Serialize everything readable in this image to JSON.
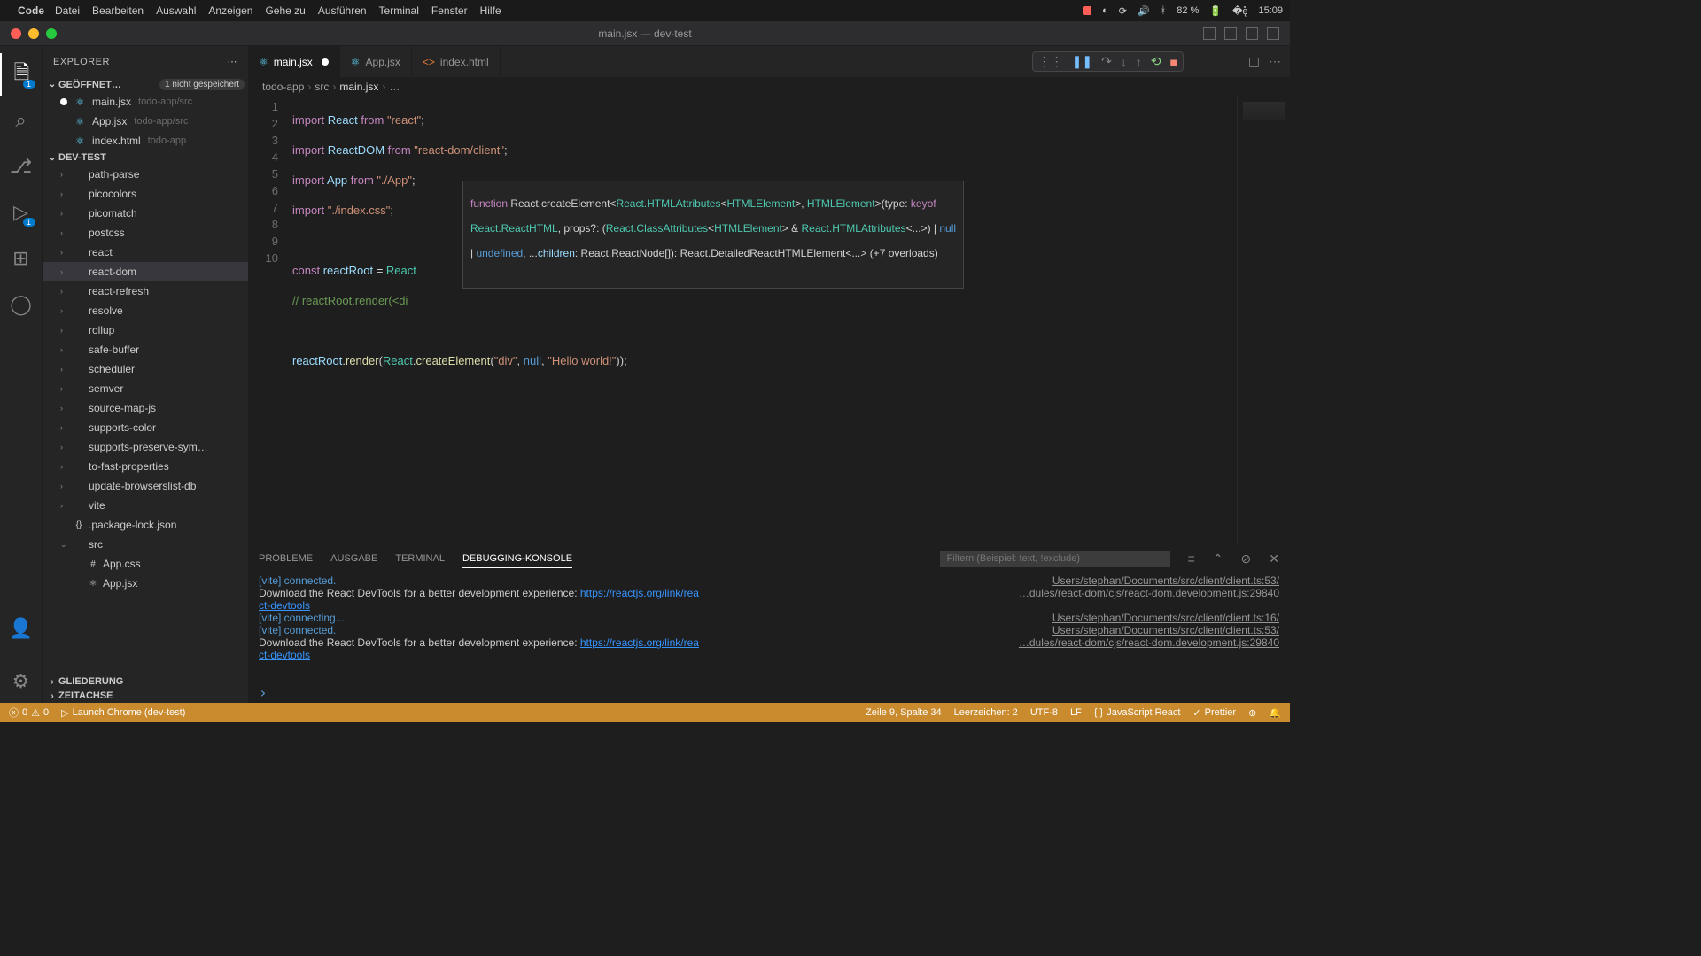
{
  "menubar": {
    "app": "Code",
    "items": [
      "Datei",
      "Bearbeiten",
      "Auswahl",
      "Anzeigen",
      "Gehe zu",
      "Ausführen",
      "Terminal",
      "Fenster",
      "Hilfe"
    ],
    "battery": "82 %",
    "time": "15:09"
  },
  "titlebar": "main.jsx — dev-test",
  "activitybar": {
    "explorer_badge": "1",
    "debug_badge": "1"
  },
  "sidebar": {
    "title": "EXPLORER",
    "open_editors": {
      "label": "GEÖFFNET…",
      "tag": "1 nicht gespeichert",
      "items": [
        {
          "name": "main.jsx",
          "path": "todo-app/src",
          "dirty": true
        },
        {
          "name": "App.jsx",
          "path": "todo-app/src",
          "dirty": false
        },
        {
          "name": "index.html",
          "path": "todo-app",
          "dirty": false
        }
      ]
    },
    "workspace": {
      "label": "DEV-TEST",
      "tree": [
        {
          "name": "path-parse",
          "type": "folder"
        },
        {
          "name": "picocolors",
          "type": "folder"
        },
        {
          "name": "picomatch",
          "type": "folder"
        },
        {
          "name": "postcss",
          "type": "folder"
        },
        {
          "name": "react",
          "type": "folder"
        },
        {
          "name": "react-dom",
          "type": "folder",
          "selected": true
        },
        {
          "name": "react-refresh",
          "type": "folder"
        },
        {
          "name": "resolve",
          "type": "folder"
        },
        {
          "name": "rollup",
          "type": "folder"
        },
        {
          "name": "safe-buffer",
          "type": "folder"
        },
        {
          "name": "scheduler",
          "type": "folder"
        },
        {
          "name": "semver",
          "type": "folder"
        },
        {
          "name": "source-map-js",
          "type": "folder"
        },
        {
          "name": "supports-color",
          "type": "folder"
        },
        {
          "name": "supports-preserve-sym…",
          "type": "folder"
        },
        {
          "name": "to-fast-properties",
          "type": "folder"
        },
        {
          "name": "update-browserslist-db",
          "type": "folder"
        },
        {
          "name": "vite",
          "type": "folder"
        },
        {
          "name": ".package-lock.json",
          "type": "file",
          "icon": "{}"
        },
        {
          "name": "src",
          "type": "folder",
          "expanded": true
        },
        {
          "name": "App.css",
          "type": "file",
          "indent": 2,
          "icon": "#"
        },
        {
          "name": "App.jsx",
          "type": "file",
          "indent": 2,
          "icon": "⚛"
        }
      ]
    },
    "outline": "GLIEDERUNG",
    "timeline": "ZEITACHSE"
  },
  "tabs": [
    {
      "name": "main.jsx",
      "icon": "⚛",
      "active": true,
      "dirty": true
    },
    {
      "name": "App.jsx",
      "icon": "⚛",
      "active": false,
      "dirty": false
    },
    {
      "name": "index.html",
      "icon": "<>",
      "active": false,
      "dirty": false
    }
  ],
  "breadcrumb": [
    "todo-app",
    "src",
    "main.jsx",
    "…"
  ],
  "code": {
    "lines": [
      "1",
      "2",
      "3",
      "4",
      "5",
      "6",
      "7",
      "8",
      "9",
      "10"
    ]
  },
  "signature": {
    "l1a": "function",
    "l1b": " React.createElement",
    "l1c": "<",
    "l1d": "React.HTMLAttributes",
    "l1e": "<",
    "l1f": "HTMLElement",
    "l1g": ">, ",
    "l1h": "HTMLElement",
    "l1i": ">(type: ",
    "l1j": "keyof",
    "l2a": "React.ReactHTML",
    "l2b": ", props?: (",
    "l2c": "React.ClassAttributes",
    "l2d": "<",
    "l2e": "HTMLElement",
    "l2f": "> & ",
    "l2g": "React.HTMLAttributes",
    "l2h": "<...>) | ",
    "l2i": "null",
    "l3a": "| ",
    "l3b": "undefined",
    "l3c": ", ...",
    "l3d": "children",
    "l3e": ": React.ReactNode[]): React.DetailedReactHTMLElement<...> (+7 overloads)"
  },
  "panel": {
    "tabs": [
      "PROBLEME",
      "AUSGABE",
      "TERMINAL",
      "DEBUGGING-KONSOLE"
    ],
    "active": 3,
    "filter_placeholder": "Filtern (Beispiel: text, !exclude)",
    "lines": [
      {
        "msg": "[vite] connected.",
        "cls": "vite",
        "loc": "Users/stephan/Documents/src/client/client.ts:53/"
      },
      {
        "msg": "Download the React DevTools for a better development experience: https://reactjs.org/link/rea",
        "loc": "…dules/react-dom/cjs/react-dom.development.js:29840"
      },
      {
        "msg2": "ct-devtools"
      },
      {
        "msg": "[vite] connecting...",
        "cls": "vite",
        "loc": "Users/stephan/Documents/src/client/client.ts:16/"
      },
      {
        "msg": "[vite] connected.",
        "cls": "vite",
        "loc": "Users/stephan/Documents/src/client/client.ts:53/"
      },
      {
        "msg": "Download the React DevTools for a better development experience: https://reactjs.org/link/rea",
        "loc": "…dules/react-dom/cjs/react-dom.development.js:29840"
      },
      {
        "msg2": "ct-devtools"
      }
    ]
  },
  "statusbar": {
    "errors": "0",
    "warnings": "0",
    "launch": "Launch Chrome (dev-test)",
    "pos": "Zeile 9, Spalte 34",
    "spaces": "Leerzeichen: 2",
    "encoding": "UTF-8",
    "eol": "LF",
    "lang": "JavaScript React",
    "prettier": "Prettier"
  }
}
